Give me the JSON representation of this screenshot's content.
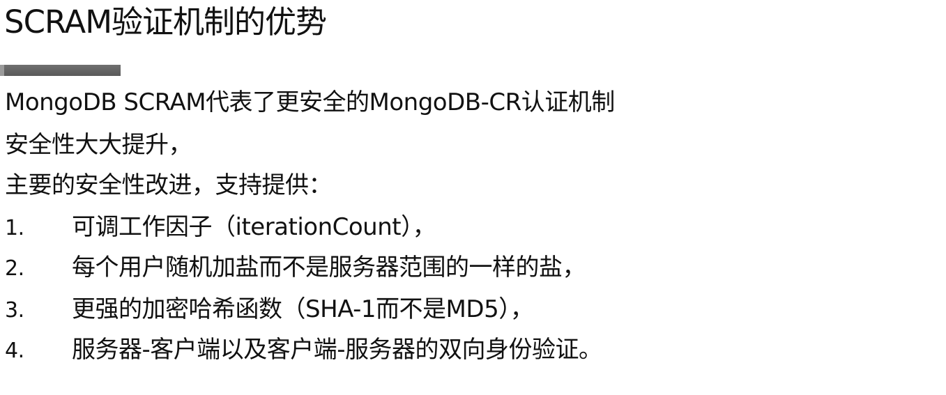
{
  "slide": {
    "title": "SCRAM验证机制的优势",
    "lines": [
      "MongoDB SCRAM代表了更安全的MongoDB-CR认证机制",
      "安全性大大提升，",
      "主要的安全性改进，支持提供："
    ],
    "items": [
      {
        "number": "1.",
        "text": "可调工作因子（iterationCount），"
      },
      {
        "number": "2.",
        "text": "每个用户随机加盐而不是服务器范围的一样的盐，"
      },
      {
        "number": "3.",
        "text": "更强的加密哈希函数（SHA-1而不是MD5），"
      },
      {
        "number": "4.",
        "text": "服务器-客户端以及客户端-服务器的双向身份验证。"
      }
    ]
  }
}
